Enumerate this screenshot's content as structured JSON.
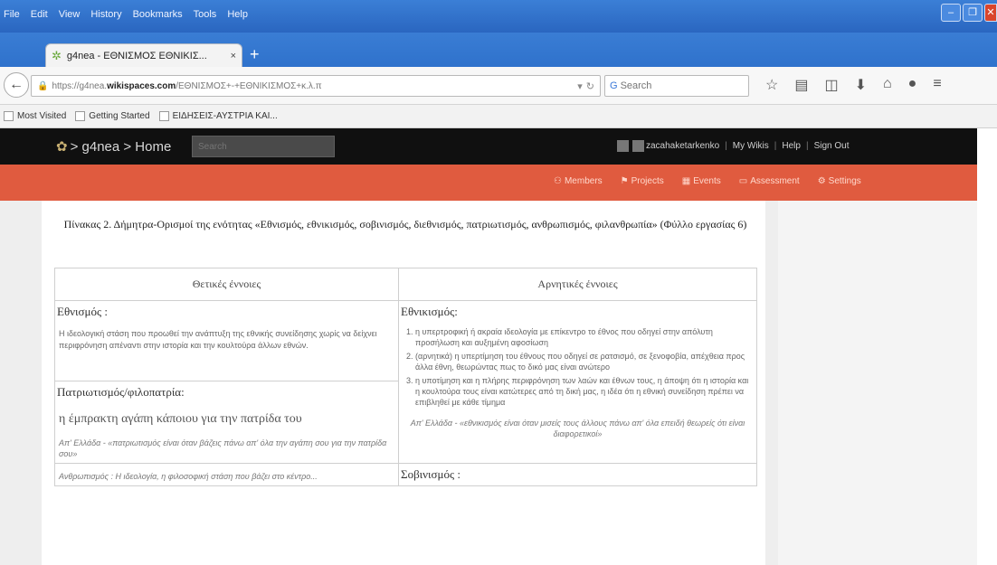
{
  "browser": {
    "menu": [
      "File",
      "Edit",
      "View",
      "History",
      "Bookmarks",
      "Tools",
      "Help"
    ],
    "tab_title": "g4nea - ΕΘΝΙΣΜΟΣ ΕΘΝΙΚΙΣ...",
    "tab_close": "×",
    "new_tab": "+",
    "url_prefix": "https://g4nea.",
    "url_domain": "wikispaces.com",
    "url_path": "/ΕΘΝΙΣΜΟΣ+-+ΕΘΝΙΚΙΣΜΟΣ+κ.λ.π",
    "search_placeholder": "Search",
    "bookmarks": [
      "Most Visited",
      "Getting Started",
      "ΕΙΔΗΣΕΙΣ-ΑΥΣΤΡΙΑ ΚΑΙ..."
    ]
  },
  "site": {
    "brand": "> g4nea > Home",
    "search_placeholder": "Search",
    "username": "zacahaketarkenko",
    "user_links": [
      "My Wikis",
      "Help",
      "Sign Out"
    ],
    "nav": [
      "Members",
      "Projects",
      "Events",
      "Assessment",
      "Settings"
    ]
  },
  "doc": {
    "caption": "Πίνακας 2. Δήμητρα-Ορισμοί της ενότητας «Εθνισμός, εθνικισμός, σοβινισμός, διεθνισμός, πατριωτισμός, ανθρωπισμός, φιλανθρωπία» (Φύλλο εργασίας 6)",
    "col_positive": "Θετικές έννοιες",
    "col_negative": "Αρνητικές έννοιες",
    "left": {
      "h1": "Εθνισμός :",
      "p1": "Η ιδεολογική στάση που προωθεί την ανάπτυξη της εθνικής συνείδησης χωρίς να δείχνει περιφρόνηση απέναντι στην ιστορία και την κουλτούρα άλλων εθνών.",
      "h2": "Πατριωτισμός/φιλοπατρία:",
      "big": "η έμπρακτη αγάπη κάποιου για την πατρίδα του",
      "p2": "Απ' Ελλάδα - «πατριωτισμός είναι όταν βάζεις πάνω απ' όλα την αγάπη σου για την πατρίδα σου»",
      "p3": "Ανθρωπισμός : Η ιδεολογία, η φιλοσοφική στάση που βάζει στο κέντρο..."
    },
    "right": {
      "h1": "Εθνικισμός:",
      "items": [
        "η υπερτροφική ή ακραία ιδεολογία με επίκεντρο το έθνος που οδηγεί στην απόλυτη προσήλωση και αυξημένη αφοσίωση",
        "(αρνητικά) η υπερτίμηση του έθνους που οδηγεί σε ρατσισμό, σε ξενοφοβία, απέχθεια προς άλλα έθνη, θεωρώντας πως το δικό μας είναι ανώτερο",
        "η υποτίμηση και η πλήρης περιφρόνηση των λαών και έθνων τους, η άποψη ότι η ιστορία και η κουλτούρα τους είναι κατώτερες από τη δική μας, η ιδέα ότι η εθνική συνείδηση πρέπει να επιβληθεί με κάθε τίμημα"
      ],
      "p": "Απ' Ελλάδα - «εθνικισμός είναι όταν μισείς τους άλλους πάνω απ' όλα επειδή θεωρείς ότι είναι διαφορετικοί»",
      "h2": "Σοβινισμός :"
    }
  }
}
